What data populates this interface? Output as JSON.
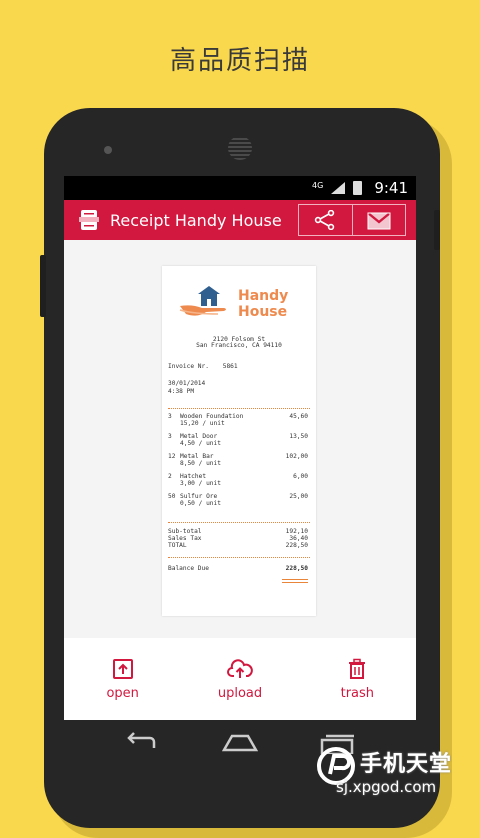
{
  "headline": "高品质扫描",
  "status": {
    "network": "4G",
    "time": "9:41"
  },
  "appbar": {
    "title": "Receipt Handy House",
    "share_icon": "share-icon",
    "mail_icon": "gmail-icon"
  },
  "receipt": {
    "brand": [
      "Handy",
      "House"
    ],
    "address": [
      "2120 Folsom St",
      "San Francisco, CA 94110"
    ],
    "invoice_label": "Invoice Nr.",
    "invoice_number": "5861",
    "date": "30/01/2014",
    "time": "4:38 PM",
    "items": [
      {
        "qty": "3",
        "name": "Wooden Foundation",
        "unit": "15,20 / unit",
        "amount": "45,60"
      },
      {
        "qty": "3",
        "name": "Metal Door",
        "unit": "4,50 / unit",
        "amount": "13,50"
      },
      {
        "qty": "12",
        "name": "Metal Bar",
        "unit": "8,50 / unit",
        "amount": "102,00"
      },
      {
        "qty": "2",
        "name": "Hatchet",
        "unit": "3,00 / unit",
        "amount": "6,00"
      },
      {
        "qty": "50",
        "name": "Sulfur Ore",
        "unit": "0,50 / unit",
        "amount": "25,00"
      }
    ],
    "subtotal_label": "Sub-total",
    "subtotal": "192,10",
    "tax_label": "Sales Tax",
    "tax": "36,40",
    "total_label": "TOTAL",
    "total": "228,50",
    "balance_label": "Balance Due",
    "balance": "228,50"
  },
  "bottom_bar": [
    {
      "label": "open",
      "icon": "open-icon"
    },
    {
      "label": "upload",
      "icon": "upload-icon"
    },
    {
      "label": "trash",
      "icon": "trash-icon"
    }
  ],
  "watermark": {
    "brand": "手机天堂",
    "url": "sj.xpgod.com"
  },
  "colors": {
    "accent": "#d2183f",
    "background": "#f9d84e",
    "brand_orange": "#ee8a4e",
    "brand_blue": "#2f5f8f"
  }
}
